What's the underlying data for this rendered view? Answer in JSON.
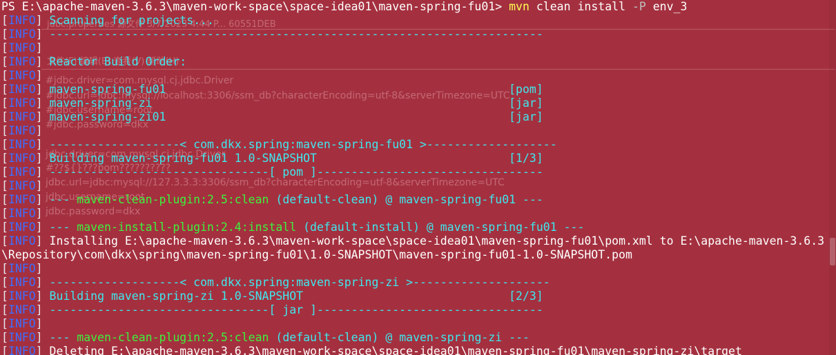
{
  "ghost_window": {
    "file_header": "jdbc.properties  源文件      3/7/2023 4:44 P...   60551DEB",
    "menu": "文件(F)   编辑(E)   查看(V)   帮助(H)",
    "text_lines": [
      "#jdbc.driver=com.mysql.cj.jdbc.Driver",
      "#jdbc.url=jdbc:mysql://localhost:3306/ssm_db?characterEncoding=utf-8&serverTimezone=UTC",
      "#jdbc.username=root",
      "#jdbc.password=dkx",
      "jdbc.driver=com.mysql.cj.jdbc.Driver",
      "#??${}???pom??????????",
      "jdbc.url=jdbc:mysql://127.3.3.3:3306/ssm_db?characterEncoding=utf-8&serverTimezone=UTC",
      "jdbc.username=root",
      "jdbc.password=dkx"
    ]
  },
  "terminal": {
    "prompt": {
      "path": "PS E:\\apache-maven-3.6.3\\maven-work-space\\space-idea01\\maven-spring-fu01>",
      "command": "mvn",
      "args": "clean install",
      "flag": "-P",
      "value": "env_3"
    },
    "info_bracket_open": "[",
    "info_level": "INFO",
    "info_bracket_close": "]",
    "lines": [
      {
        "text": " Scanning for projects...",
        "color": "cyan"
      },
      {
        "text": " ------------------------------------------------------------------------",
        "color": "cyan"
      },
      {
        "text": "",
        "color": "cyan"
      },
      {
        "text": " Reactor Build Order:",
        "color": "cyan"
      },
      {
        "text": "",
        "color": "cyan"
      },
      {
        "text": " maven-spring-fu01                                                  [pom]",
        "color": "cyan"
      },
      {
        "text": " maven-spring-zi                                                    [jar]",
        "color": "cyan"
      },
      {
        "text": " maven-spring-zi01                                                  [jar]",
        "color": "cyan"
      },
      {
        "text": "",
        "color": "cyan"
      },
      {
        "text": " -------------------< com.dkx.spring:maven-spring-fu01 >-------------------",
        "color": "cyan"
      },
      {
        "text": " Building maven-spring-fu01 1.0-SNAPSHOT                            [1/3]",
        "color": "cyan"
      },
      {
        "text": " --------------------------------[ pom ]---------------------------------",
        "color": "cyan"
      },
      {
        "text": "",
        "color": "cyan"
      },
      {
        "parts": [
          {
            "text": " --- ",
            "color": "cyan"
          },
          {
            "text": "maven-clean-plugin:2.5:clean",
            "color": "green"
          },
          {
            "text": " (default-clean) @ maven-spring-fu01 ---",
            "color": "cyan"
          }
        ]
      },
      {
        "text": "",
        "color": "cyan"
      },
      {
        "parts": [
          {
            "text": " --- ",
            "color": "cyan"
          },
          {
            "text": "maven-install-plugin:2.4:install",
            "color": "green"
          },
          {
            "text": " (default-install) @ maven-spring-fu01 ---",
            "color": "cyan"
          }
        ]
      },
      {
        "text": " Installing E:\\apache-maven-3.6.3\\maven-work-space\\space-idea01\\maven-spring-fu01\\pom.xml to E:\\apache-maven-3.6.3",
        "color": "white"
      },
      {
        "raw": "\\Repository\\com\\dkx\\spring\\maven-spring-fu01\\1.0-SNAPSHOT\\maven-spring-fu01-1.0-SNAPSHOT.pom",
        "color": "white"
      },
      {
        "text": "",
        "color": "cyan"
      },
      {
        "text": " -------------------< com.dkx.spring:maven-spring-zi >--------------------",
        "color": "cyan"
      },
      {
        "text": " Building maven-spring-zi 1.0-SNAPSHOT                              [2/3]",
        "color": "cyan"
      },
      {
        "text": " --------------------------------[ jar ]---------------------------------",
        "color": "cyan"
      },
      {
        "text": "",
        "color": "cyan"
      },
      {
        "parts": [
          {
            "text": " --- ",
            "color": "cyan"
          },
          {
            "text": "maven-clean-plugin:2.5:clean",
            "color": "green"
          },
          {
            "text": " (default-clean) @ maven-spring-zi ---",
            "color": "cyan"
          }
        ]
      },
      {
        "text": " Deleting E:\\apache-maven-3.6.3\\maven-work-space\\space-idea01\\maven-spring-fu01\\maven-spring-zi\\target",
        "color": "white"
      },
      {
        "text": "",
        "color": "cyan"
      }
    ]
  },
  "colors": {
    "background": "#a4303f",
    "info_level": "#3d6eff",
    "cyan": "#3fe8ee",
    "green": "#3df23d",
    "yellow": "#ffff50"
  }
}
